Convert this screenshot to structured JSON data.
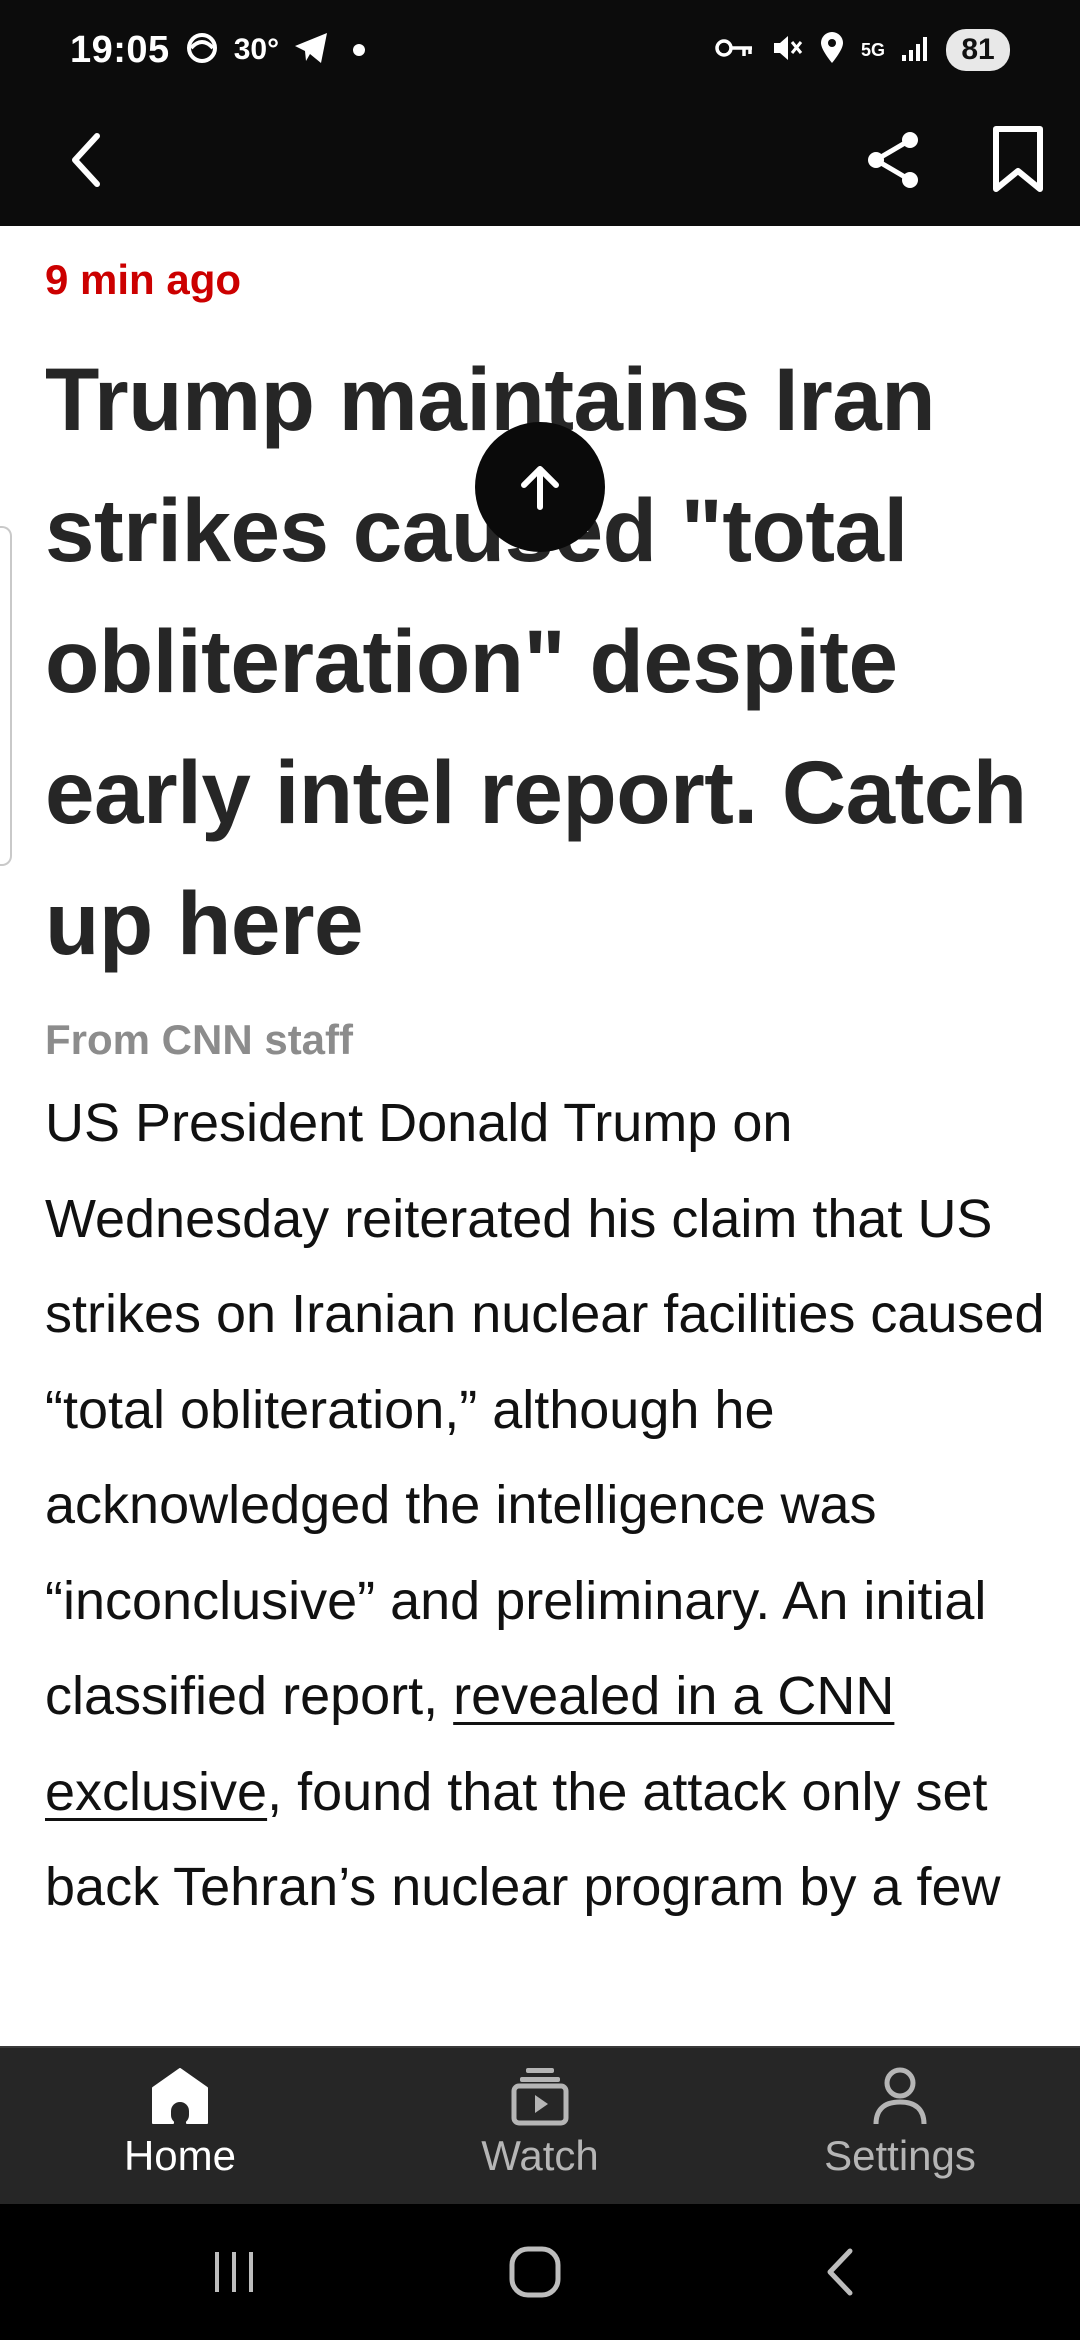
{
  "status_bar": {
    "time": "19:05",
    "temperature": "30°",
    "network_label_top": "5G",
    "battery": "81"
  },
  "header": {
    "back_icon": "chevron-left-icon",
    "share_icon": "share-icon",
    "bookmark_icon": "bookmark-icon"
  },
  "article": {
    "timestamp": "9 min ago",
    "headline": "Trump maintains Iran strikes caused \"total obliteration\" despite early intel report. Catch up here",
    "byline": "From CNN staff",
    "body_before_link": "US President Donald Trump on Wednesday reiterated his claim that US strikes on Iranian nuclear facilities caused “total obliteration,” although he acknowledged the intelligence was “inconclusive” and preliminary. An initial classified report, ",
    "link_text": "revealed in a CNN exclusive",
    "body_after_link": ", found that the attack only set back Tehran’s nuclear program by a few"
  },
  "bottom_nav": {
    "items": [
      {
        "label": "Home",
        "icon": "home-icon",
        "active": true
      },
      {
        "label": "Watch",
        "icon": "watch-icon",
        "active": false
      },
      {
        "label": "Settings",
        "icon": "person-icon",
        "active": false
      }
    ]
  },
  "colors": {
    "accent_red": "#cc0000",
    "header_bg": "#0c0c0c",
    "nav_bg": "#262626"
  }
}
